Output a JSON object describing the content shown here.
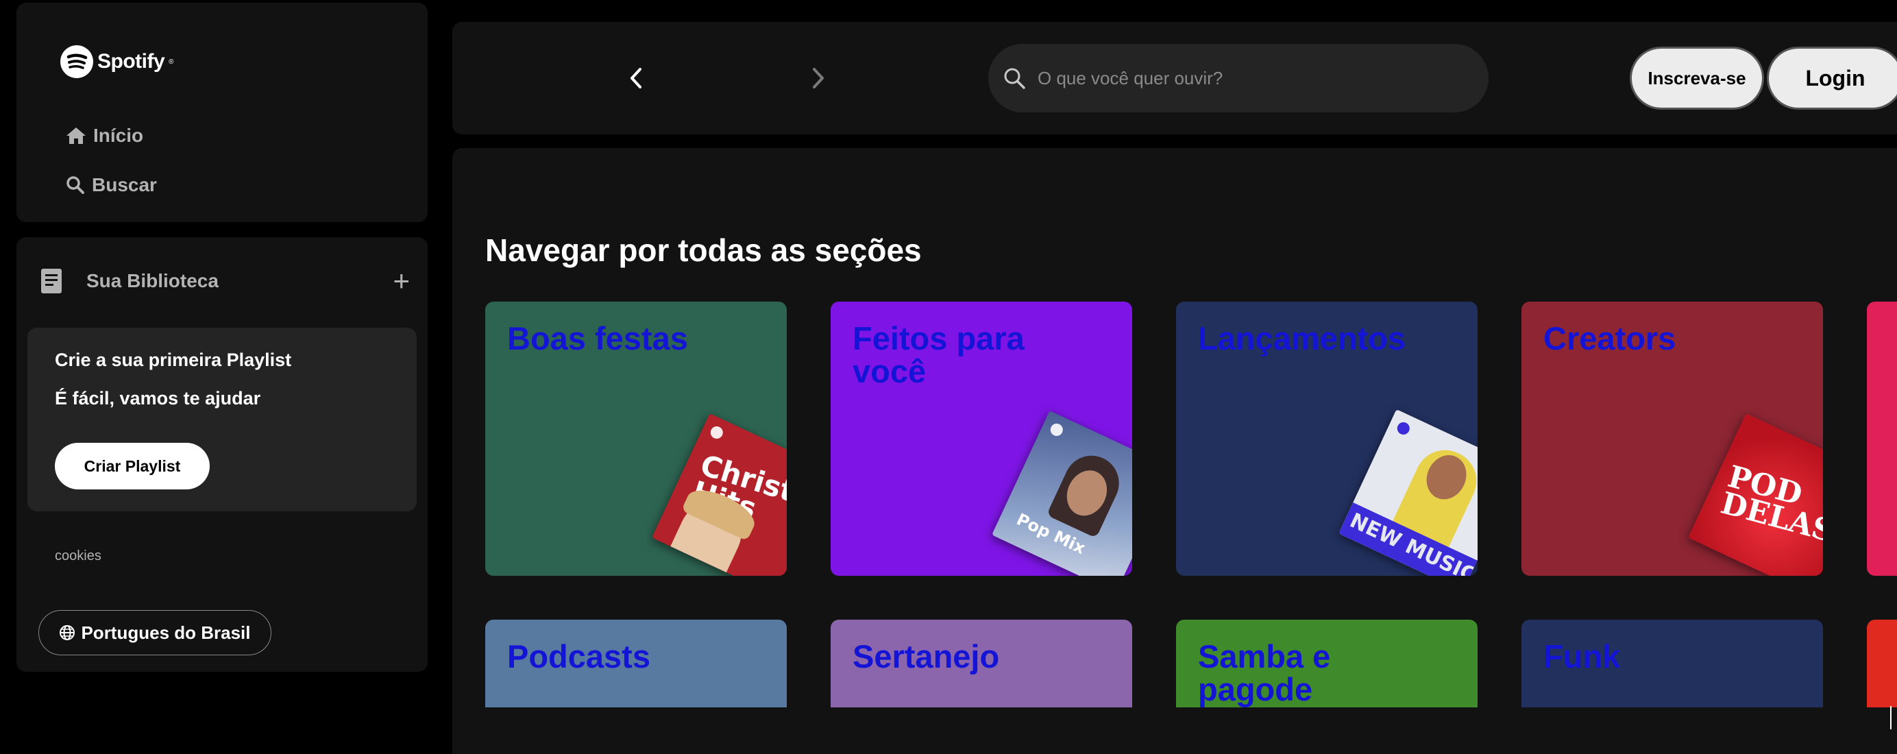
{
  "sidebar": {
    "logo": {
      "text": "Spotify",
      "icon": "spotify-logo-icon"
    },
    "nav": [
      {
        "label": "Início",
        "icon": "home-icon"
      },
      {
        "label": "Buscar",
        "icon": "search-icon"
      }
    ],
    "library": {
      "title": "Sua Biblioteca",
      "icon": "library-icon",
      "add_label": "+",
      "create_card": {
        "title": "Crie a sua primeira Playlist",
        "subtitle": "É fácil, vamos te ajudar",
        "button_label": "Criar Playlist"
      },
      "cookies_label": "cookies",
      "language_label": "Portugues do Brasil",
      "language_icon": "globe-icon"
    }
  },
  "topbar": {
    "back_icon": "chevron-left-icon",
    "forward_icon": "chevron-right-icon",
    "search": {
      "placeholder": "O que você quer ouvir?",
      "value": "",
      "icon": "search-icon"
    },
    "signup_label": "Inscreva-se",
    "login_label": "Login"
  },
  "main": {
    "section_title": "Navegar por todas as seções",
    "cards": [
      {
        "label": "Boas festas",
        "color": "#2d6451",
        "art_text": "Christmas Hits",
        "art_color": "#b3222a"
      },
      {
        "label": "Feitos para você",
        "color": "#7e15e6",
        "art_text": "Pop Mix",
        "art_color": "#6a7fb0"
      },
      {
        "label": "Lançamentos",
        "color": "#22305e",
        "art_text": "NEW MUSIC FRIDAY",
        "art_color": "#e5e8ef"
      },
      {
        "label": "Creators",
        "color": "#8d2533",
        "art_text": "POD DELAS",
        "art_color": "#d3202c"
      },
      {
        "label": "Podcasts",
        "color": "#587aa0"
      },
      {
        "label": "Sertanejo",
        "color": "#8b66ac"
      },
      {
        "label": "Samba e pagode",
        "color": "#3f8a2b"
      },
      {
        "label": "Funk",
        "color": "#22305e"
      }
    ],
    "peek_colors": [
      "#e1205a",
      "#e02a1f"
    ]
  },
  "colors": {
    "background": "#000000",
    "panel": "#121212",
    "card_text": "#1414d6"
  }
}
